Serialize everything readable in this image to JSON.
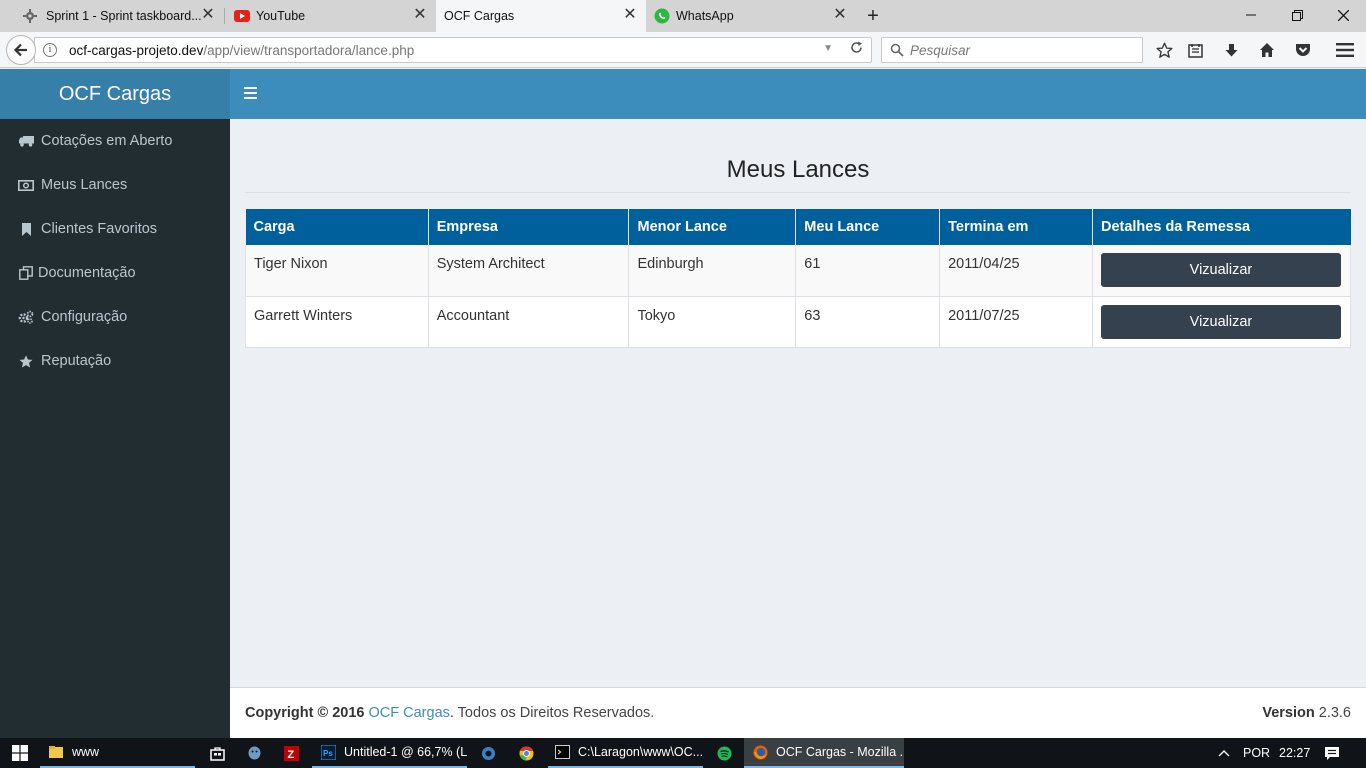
{
  "browser": {
    "tabs": [
      {
        "label": "Sprint 1 - Sprint taskboard...",
        "active": false
      },
      {
        "label": "YouTube",
        "active": false
      },
      {
        "label": "OCF Cargas",
        "active": true
      },
      {
        "label": "WhatsApp",
        "active": false
      }
    ],
    "url_domain": "ocf-cargas-projeto.dev",
    "url_path": "/app/view/transportadora/lance.php",
    "search_placeholder": "Pesquisar"
  },
  "app": {
    "logo": "OCF Cargas",
    "sidebar": [
      {
        "label": "Cotações em Aberto",
        "icon": "truck-icon"
      },
      {
        "label": "Meus Lances",
        "icon": "money-icon"
      },
      {
        "label": "Clientes Favoritos",
        "icon": "bookmark-icon"
      },
      {
        "label": "Documentação",
        "icon": "copy-icon"
      },
      {
        "label": "Configuração",
        "icon": "cogs-icon"
      },
      {
        "label": "Reputação",
        "icon": "star-icon"
      }
    ],
    "page_title": "Meus Lances",
    "table": {
      "headers": [
        "Carga",
        "Empresa",
        "Menor Lance",
        "Meu Lance",
        "Termina em",
        "Detalhes da Remessa"
      ],
      "rows": [
        {
          "carga": "Tiger Nixon",
          "empresa": "System Architect",
          "menor_lance": "Edinburgh",
          "meu_lance": "61",
          "termina_em": "2011/04/25",
          "button": "Vizualizar"
        },
        {
          "carga": "Garrett Winters",
          "empresa": "Accountant",
          "menor_lance": "Tokyo",
          "meu_lance": "63",
          "termina_em": "2011/07/25",
          "button": "Vizualizar"
        }
      ]
    },
    "footer": {
      "copyright": "Copyright © 2016",
      "brand": "OCF Cargas",
      "rights": ". Todos os Direitos Reservados.",
      "version_label": "Version",
      "version": "2.3.6"
    }
  },
  "taskbar": {
    "items": [
      {
        "label": "www"
      },
      {
        "label": "Untitled-1 @ 66,7% (L..."
      },
      {
        "label": "C:\\Laragon\\www\\OC..."
      },
      {
        "label": "OCF Cargas - Mozilla ..."
      }
    ],
    "language": "POR",
    "time": "22:27"
  },
  "colors": {
    "topbar": "#3c8dbc",
    "logo_bg": "#367fa9",
    "sidebar_bg": "#222d32",
    "table_header": "#00609c",
    "button": "#364150"
  }
}
